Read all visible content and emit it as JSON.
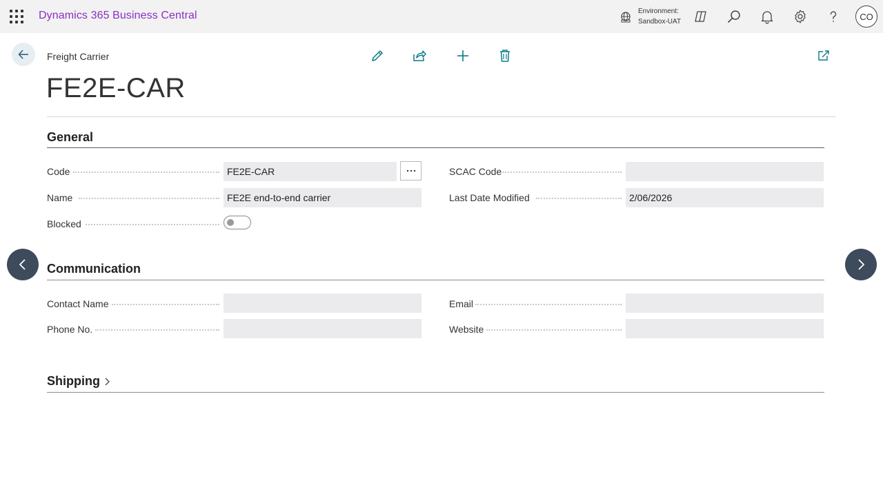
{
  "app": {
    "title": "Dynamics 365 Business Central"
  },
  "environment": {
    "label": "Environment:",
    "value": "Sandbox-UAT"
  },
  "user": {
    "initials": "CO"
  },
  "page": {
    "entity": "Freight Carrier",
    "title": "FE2E-CAR"
  },
  "icons": {
    "waffle": "app-launcher-icon",
    "environment": "environment-icon",
    "copilot": "copilot-icon",
    "search": "search-icon",
    "notifications": "bell-icon",
    "settings": "gear-icon",
    "help": "help-icon",
    "back": "back-arrow-icon",
    "edit": "pencil-icon",
    "share": "share-icon",
    "new": "plus-icon",
    "delete": "trash-icon",
    "popout": "open-in-new-window-icon",
    "prev": "chevron-left-icon",
    "next": "chevron-right-icon"
  },
  "sections": {
    "general": {
      "title": "General",
      "code": {
        "label": "Code",
        "value": "FE2E-CAR"
      },
      "name": {
        "label": "Name",
        "value": "FE2E end-to-end carrier"
      },
      "blocked": {
        "label": "Blocked",
        "value": false
      },
      "scac": {
        "label": "SCAC Code",
        "value": ""
      },
      "last_modified": {
        "label": "Last Date Modified",
        "value": "2/06/2026"
      }
    },
    "communication": {
      "title": "Communication",
      "contact": {
        "label": "Contact Name",
        "value": ""
      },
      "phone": {
        "label": "Phone No.",
        "value": ""
      },
      "email": {
        "label": "Email",
        "value": ""
      },
      "website": {
        "label": "Website",
        "value": ""
      }
    },
    "shipping": {
      "title": "Shipping"
    }
  },
  "colors": {
    "brand": "#8a2dc5",
    "accent": "#0a7a8a",
    "nav": "#3d4b5c"
  }
}
